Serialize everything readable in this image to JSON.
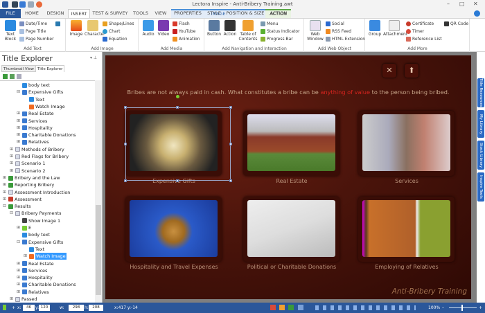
{
  "window": {
    "title": "Lectora Inspire - Anti-Bribery Training.awt"
  },
  "ribbon_tabs": [
    {
      "label": "FILE"
    },
    {
      "label": "HOME"
    },
    {
      "label": "DESIGN"
    },
    {
      "label": "INSERT"
    },
    {
      "label": "TEST & SURVEY"
    },
    {
      "label": "TOOLS"
    },
    {
      "label": "VIEW"
    },
    {
      "label": "PROPERTIES"
    },
    {
      "label": "STYLE"
    },
    {
      "label": "POSITION & SIZE"
    },
    {
      "label": "ACTION"
    }
  ],
  "contextual": {
    "image": "IMAGE",
    "action": "ACTION"
  },
  "groups": {
    "add_text": {
      "label": "Add Text",
      "text_block": "Text Block",
      "date_time": "Date/Time",
      "page_title": "Page Title",
      "page_number": "Page Number"
    },
    "add_image": {
      "label": "Add Image",
      "image": "Image",
      "character": "Character",
      "shape_lines": "Shape/Lines",
      "chart": "Chart",
      "equation": "Equation"
    },
    "add_media": {
      "label": "Add Media",
      "audio": "Audio",
      "video": "Video",
      "flash": "Flash",
      "youtube": "YouTube",
      "animation": "Animation"
    },
    "add_nav": {
      "label": "Add Navigation and Interaction",
      "button": "Button",
      "action": "Action",
      "toc": "Table of Contents",
      "menu": "Menu",
      "status_indicator": "Status Indicator",
      "progress_bar": "Progress Bar"
    },
    "add_web": {
      "label": "Add Web Object",
      "web_window": "Web Window",
      "social": "Social",
      "rss_feed": "RSS Feed",
      "html_extension": "HTML Extension"
    },
    "add_more": {
      "label": "Add More",
      "group": "Group",
      "attachment": "Attachment",
      "certificate": "Certificate",
      "timer": "Timer",
      "reference_list": "Reference List",
      "qr_code": "QR Code"
    }
  },
  "left_panel": {
    "title": "Title Explorer",
    "tabs": [
      "Thumbnail View",
      "Title Explorer"
    ],
    "tree": [
      {
        "label": "body text",
        "level": 4,
        "icon": "text"
      },
      {
        "label": "Expensive Gifts",
        "level": 4,
        "icon": "group",
        "exp": "-"
      },
      {
        "label": "Text",
        "level": 5,
        "icon": "text"
      },
      {
        "label": "Watch Image",
        "level": 5,
        "icon": "image"
      },
      {
        "label": "Real Estate",
        "level": 4,
        "icon": "group",
        "exp": "+"
      },
      {
        "label": "Services",
        "level": 4,
        "icon": "group",
        "exp": "+"
      },
      {
        "label": "Hospitality",
        "level": 4,
        "icon": "group",
        "exp": "+"
      },
      {
        "label": "Charitable Donations",
        "level": 4,
        "icon": "group",
        "exp": "+"
      },
      {
        "label": "Relatives",
        "level": 4,
        "icon": "group",
        "exp": "+"
      },
      {
        "label": "Methods of Bribery",
        "level": 3,
        "icon": "page",
        "exp": "+"
      },
      {
        "label": "Red Flags for Bribery",
        "level": 3,
        "icon": "page",
        "exp": "+"
      },
      {
        "label": "Scenario 1",
        "level": 3,
        "icon": "page",
        "exp": "+"
      },
      {
        "label": "Scenario 2",
        "level": 3,
        "icon": "page",
        "exp": "+"
      },
      {
        "label": "Bribery and the Law",
        "level": 2,
        "icon": "chapter",
        "exp": "+"
      },
      {
        "label": "Reporting Bribery",
        "level": 2,
        "icon": "chapter",
        "exp": "+"
      },
      {
        "label": "Assessment Introduction",
        "level": 2,
        "icon": "page",
        "exp": "+"
      },
      {
        "label": "Assessment",
        "level": 2,
        "icon": "test",
        "exp": "+"
      },
      {
        "label": "Results",
        "level": 2,
        "icon": "chapter",
        "exp": "-"
      },
      {
        "label": "Bribery Payments",
        "level": 3,
        "icon": "page",
        "exp": "-"
      },
      {
        "label": "Show Image 1",
        "level": 4,
        "icon": "action"
      },
      {
        "label": "E",
        "level": 4,
        "icon": "button",
        "exp": "+"
      },
      {
        "label": "body text",
        "level": 4,
        "icon": "text"
      },
      {
        "label": "Expensive Gifts",
        "level": 4,
        "icon": "group",
        "exp": "-"
      },
      {
        "label": "Text",
        "level": 5,
        "icon": "text"
      },
      {
        "label": "Watch Image",
        "level": 5,
        "icon": "image",
        "selected": true,
        "exp": "+"
      },
      {
        "label": "Real Estate",
        "level": 4,
        "icon": "group",
        "exp": "+"
      },
      {
        "label": "Services",
        "level": 4,
        "icon": "group",
        "exp": "+"
      },
      {
        "label": "Hospitality",
        "level": 4,
        "icon": "group",
        "exp": "+"
      },
      {
        "label": "Charitable Donations",
        "level": 4,
        "icon": "group",
        "exp": "+"
      },
      {
        "label": "Relatives",
        "level": 4,
        "icon": "group",
        "exp": "+"
      },
      {
        "label": "Passed",
        "level": 3,
        "icon": "page",
        "exp": "+"
      }
    ]
  },
  "slide": {
    "headline_pre": "Bribes are not always paid in cash. What constitutes a bribe can be ",
    "headline_highlight": "anything of value",
    "headline_post": " to the person being bribed.",
    "highlight_color": "#d8241e",
    "close_glyph": "✕",
    "up_glyph": "⬆",
    "cards": [
      {
        "label": "Expensive Gifts",
        "image": "watch"
      },
      {
        "label": "Real Estate",
        "image": "house"
      },
      {
        "label": "Services",
        "image": "barber"
      },
      {
        "label": "Hospitality and Travel Expenses",
        "image": "roulette"
      },
      {
        "label": "Political or Charitable Donations",
        "image": "check"
      },
      {
        "label": "Employing of Relatives",
        "image": "office-door"
      }
    ],
    "brand": "Anti-Bribery Training"
  },
  "right_tabs": [
    "Title Resources",
    "My Library",
    "Stock Library",
    "Inspire Tools"
  ],
  "status": {
    "x_label": "x:",
    "x": "46",
    "y_label": "y:",
    "y": "120",
    "w_label": "w:",
    "w": "298",
    "h_label": "h:",
    "h": "208",
    "cursor": "x:417 y:-14",
    "zoom": "100%"
  }
}
